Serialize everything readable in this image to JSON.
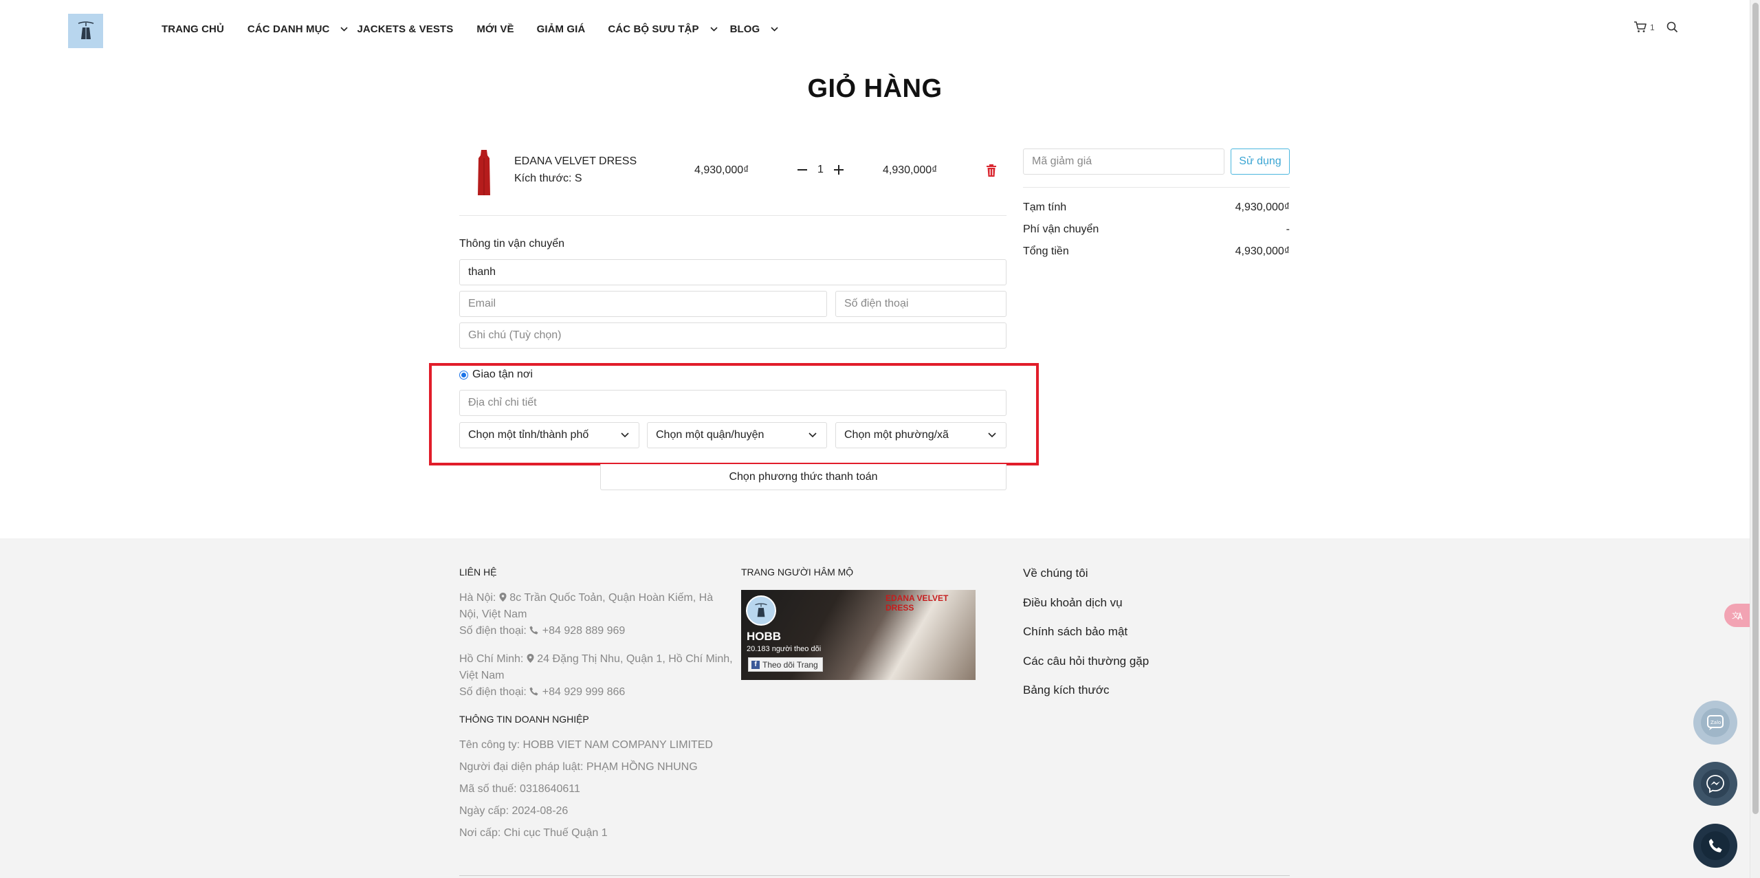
{
  "header": {
    "nav": [
      {
        "label": "TRANG CHỦ",
        "has_caret": false
      },
      {
        "label": "CÁC DANH MỤC",
        "has_caret": true
      },
      {
        "label": "JACKETS & VESTS",
        "has_caret": false
      },
      {
        "label": "MỚI VỀ",
        "has_caret": false
      },
      {
        "label": "GIẢM GIÁ",
        "has_caret": false
      },
      {
        "label": "CÁC BỘ SƯU TẬP",
        "has_caret": true
      },
      {
        "label": "BLOG",
        "has_caret": true
      }
    ],
    "cart_count": "1",
    "icons": {
      "logo": "hobb-logo",
      "cart": "cart-icon",
      "search": "search-icon"
    }
  },
  "page": {
    "title": "GIỎ HÀNG"
  },
  "cart_item": {
    "name": "EDANA VELVET DRESS",
    "size": "Kích thước: S",
    "price": "4,930,000₫",
    "quantity": "1",
    "total": "4,930,000₫"
  },
  "shipping": {
    "section_label": "Thông tin vận chuyển",
    "name_value": "thanh",
    "email_placeholder": "Email",
    "phone_placeholder": "Số điện thoại",
    "note_placeholder": "Ghi chú (Tuỳ chọn)",
    "delivery_option": "Giao tận nơi",
    "address_placeholder": "Địa chỉ chi tiết",
    "province_select": "Chọn một tỉnh/thành phố",
    "district_select": "Chọn một quận/huyện",
    "ward_select": "Chọn một phường/xã",
    "payment_button": "Chọn phương thức thanh toán"
  },
  "summary": {
    "coupon_placeholder": "Mã giảm giá",
    "apply_button": "Sử dụng",
    "rows": [
      {
        "label": "Tạm tính",
        "value": "4,930,000₫"
      },
      {
        "label": "Phí vận chuyển",
        "value": "-"
      },
      {
        "label": "Tổng tiền",
        "value": "4,930,000₫"
      }
    ]
  },
  "footer": {
    "contact_heading": "LIÊN HỆ",
    "hanoi_line1": "Hà Nội:",
    "hanoi_address": "8c Trần Quốc Toản, Quận Hoàn Kiếm, Hà",
    "hanoi_address2": "Nội, Việt Nam",
    "hanoi_phone_label": "Số điện thoại:",
    "hanoi_phone": "+84 928 889 969",
    "hcm_line1": "Hồ Chí Minh:",
    "hcm_address": "24 Đặng Thị Nhu, Quận 1, Hồ Chí Minh,",
    "hcm_address2": "Việt Nam",
    "hcm_phone_label": "Số điện thoại:",
    "hcm_phone": "+84 929 999 866",
    "business_heading": "THÔNG TIN DOANH NGHIỆP",
    "company": "Tên công ty: HOBB VIET NAM COMPANY LIMITED",
    "representative": "Người đại diện pháp luật: PHẠM HỒNG NHUNG",
    "tax_code": "Mã số thuế: 0318640611",
    "issue_date": "Ngày cấp: 2024-08-26",
    "issue_place": "Nơi cấp: Chi cục Thuế Quận 1",
    "fanpage_heading": "TRANG NGƯỜI HÂM MỘ",
    "fb_name": "HOBB",
    "fb_followers": "20.183 người theo dõi",
    "fb_follow": "Theo dõi Trang",
    "links": [
      "Về chúng tôi",
      "Điều khoản dịch vụ",
      "Chính sách bảo mật",
      "Các câu hỏi thường gặp",
      "Bảng kích thước"
    ]
  },
  "colors": {
    "highlight": "#e11d2a",
    "accent": "#3aa5d3",
    "delete": "#d9262f",
    "dress": "#b51c1c"
  }
}
